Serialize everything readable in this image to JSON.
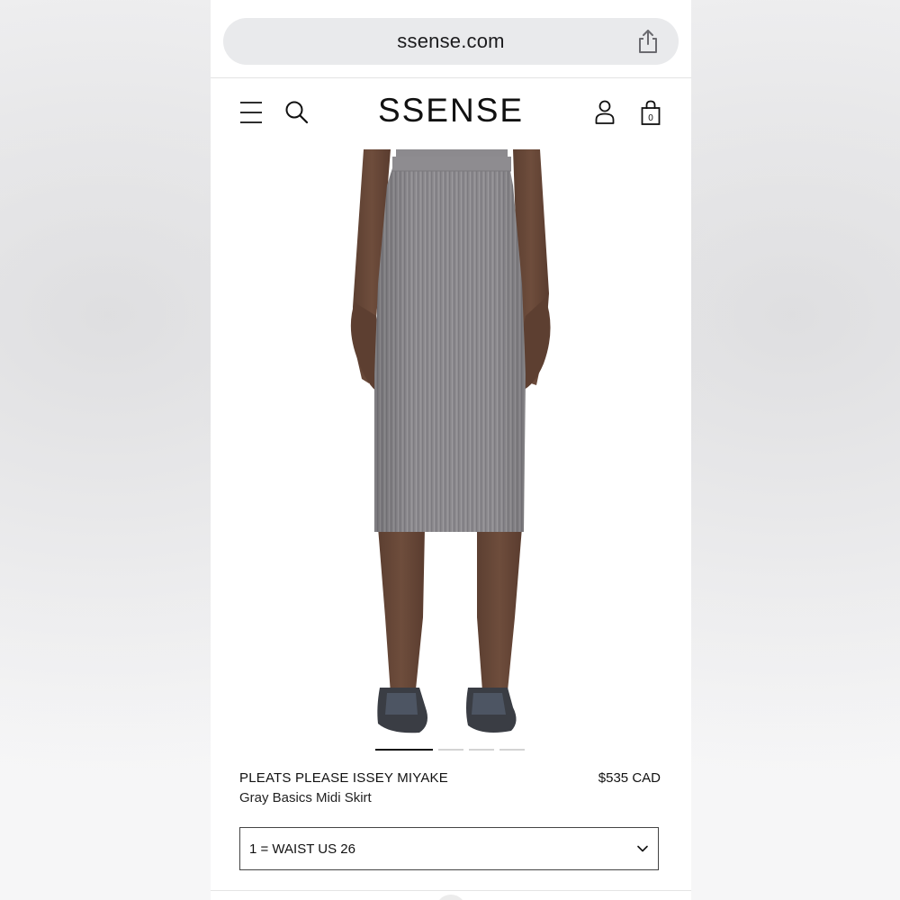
{
  "browser": {
    "url": "ssense.com"
  },
  "header": {
    "logo": "SSENSE",
    "cart_count": "0"
  },
  "product": {
    "brand": "PLEATS PLEASE ISSEY MIYAKE",
    "name": "Gray Basics Midi Skirt",
    "price": "$535 CAD",
    "size_selected": "1 = WAIST US 26",
    "image_count": 4,
    "active_image": 1
  },
  "icons": {
    "share": "share-icon",
    "menu": "hamburger-menu-icon",
    "search": "search-icon",
    "account": "user-icon",
    "bag": "shopping-bag-icon",
    "dropdown": "chevron-down-icon"
  },
  "colors": {
    "skirt": "#8b898d",
    "skin": "#6a4a3a",
    "text": "#111111"
  }
}
